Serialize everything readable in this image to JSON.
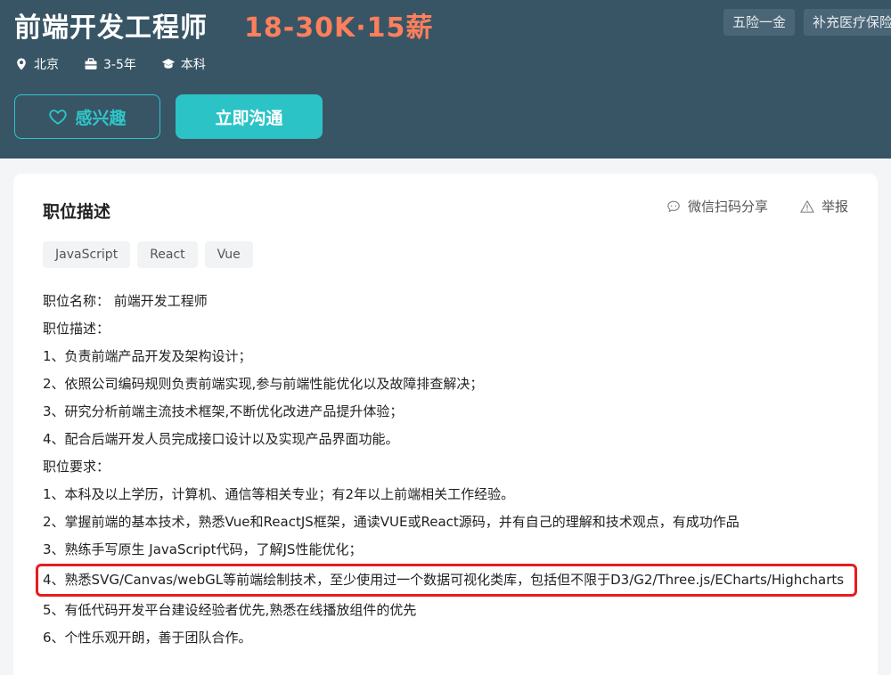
{
  "job": {
    "title": "前端开发工程师",
    "salary": "18-30K·15薪",
    "benefits": [
      "五险一金",
      "补充医疗保险"
    ],
    "meta": {
      "location": "北京",
      "experience": "3-5年",
      "education": "本科"
    }
  },
  "buttons": {
    "interest": "感兴趣",
    "chat": "立即沟通"
  },
  "card": {
    "section_title": "职位描述",
    "share_label": "微信扫码分享",
    "report_label": "举报",
    "tags": [
      "JavaScript",
      "React",
      "Vue"
    ],
    "lines": [
      "职位名称：  前端开发工程师",
      "职位描述：",
      "1、负责前端产品开发及架构设计；",
      "2、依照公司编码规则负责前端实现,参与前端性能优化以及故障排查解决；",
      "3、研究分析前端主流技术框架,不断优化改进产品提升体验；",
      "4、配合后端开发人员完成接口设计以及实现产品界面功能。",
      "职位要求：",
      "1、本科及以上学历，计算机、通信等相关专业；有2年以上前端相关工作经验。",
      "2、掌握前端的基本技术，熟悉Vue和ReactJS框架，通读VUE或React源码，并有自己的理解和技术观点，有成功作品",
      "3、熟练手写原生 JavaScript代码，了解JS性能优化；",
      "4、熟悉SVG/Canvas/webGL等前端绘制技术，至少使用过一个数据可视化类库，包括但不限于D3/G2/Three.js/ECharts/Highcharts",
      "5、有低代码开发平台建设经验者优先,熟悉在线播放组件的优先",
      "6、个性乐观开朗，善于团队合作。"
    ]
  },
  "colors": {
    "header_bg": "#385566",
    "salary": "#fe7f5c",
    "accent": "#2cc3c6",
    "highlight_border": "#e81c1c"
  },
  "icons": {
    "location": "location-pin-icon",
    "experience": "briefcase-icon",
    "education": "graduation-cap-icon",
    "interest": "heart-icon",
    "share": "chat-bubble-icon",
    "report": "warning-triangle-icon"
  }
}
